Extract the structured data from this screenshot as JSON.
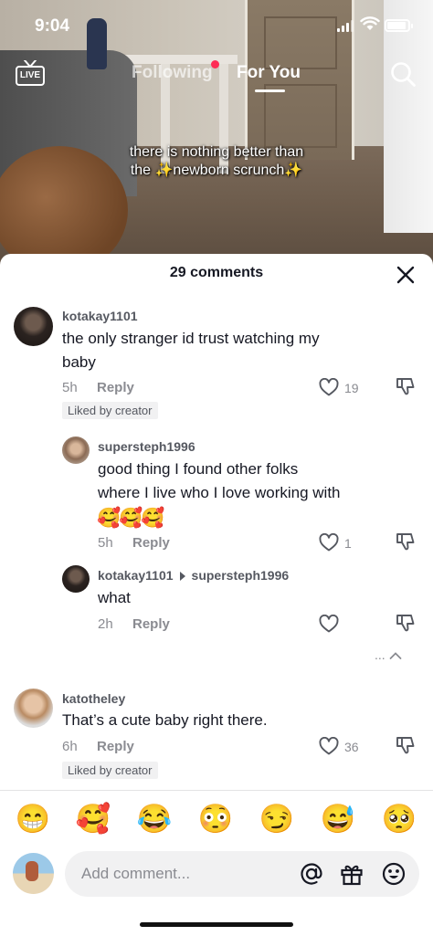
{
  "status_bar": {
    "time": "9:04"
  },
  "nav": {
    "live_label": "LIVE",
    "tabs": [
      {
        "label": "Following",
        "has_dot": true
      },
      {
        "label": "For You",
        "active": true
      }
    ]
  },
  "video": {
    "caption_line1": "there is nothing better than",
    "caption_line2": "the ✨newborn scrunch✨"
  },
  "comments_sheet": {
    "title": "29 comments",
    "comments": [
      {
        "username": "kotakay1101",
        "text_line1": "the only stranger id trust watching my",
        "text_line2": "baby",
        "time": "5h",
        "reply_label": "Reply",
        "likes": "19",
        "liked_by_creator": "Liked by creator"
      },
      {
        "username": "supersteph1996",
        "text_line1": "good thing I found other folks",
        "text_line2": "where I live who I love working with",
        "emojis": "🥰🥰🥰",
        "time": "5h",
        "reply_label": "Reply",
        "likes": "1"
      },
      {
        "username": "kotakay1101",
        "reply_to": "supersteph1996",
        "text_line1": "what",
        "time": "2h",
        "reply_label": "Reply"
      },
      {
        "username": "katotheley",
        "text_line1": "That’s a cute baby right there.",
        "time": "6h",
        "reply_label": "Reply",
        "likes": "36",
        "liked_by_creator": "Liked by creator"
      }
    ],
    "more_replies_label": "..."
  },
  "emoji_bar": [
    "😁",
    "🥰",
    "😂",
    "😳",
    "😏",
    "😅",
    "🥺"
  ],
  "composer": {
    "placeholder": "Add comment..."
  },
  "icons": [
    "live-icon",
    "search-icon",
    "close-icon",
    "heart-icon",
    "dislike-icon",
    "at-icon",
    "gift-icon",
    "emoji-icon"
  ]
}
